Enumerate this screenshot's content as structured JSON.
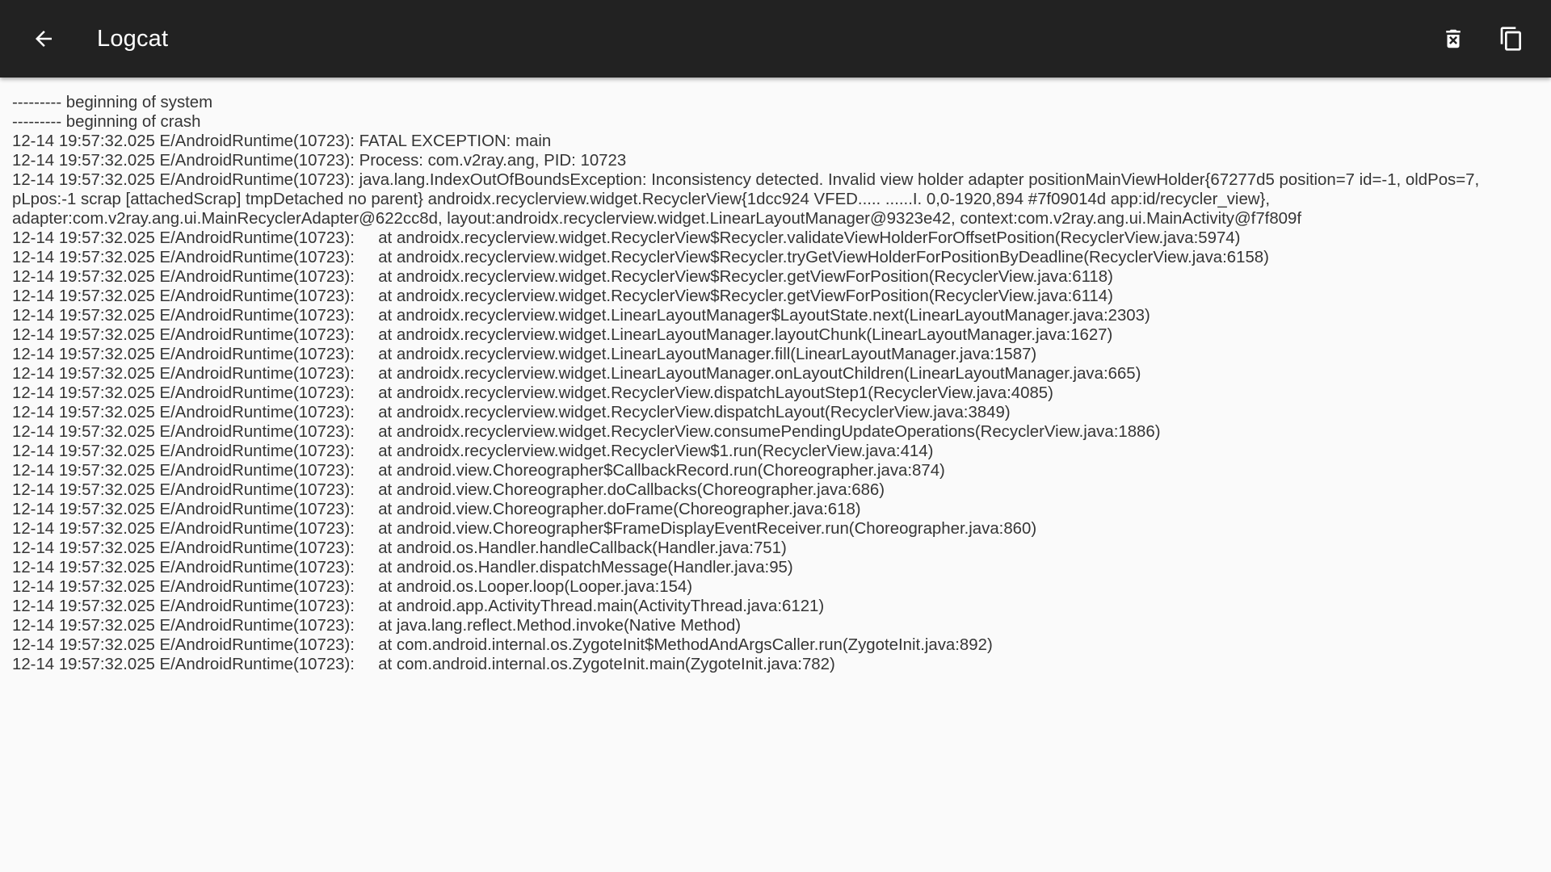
{
  "appbar": {
    "title": "Logcat",
    "back_icon": "arrow-back-icon",
    "delete_icon": "delete-icon",
    "copy_icon": "copy-icon"
  },
  "colors": {
    "appbar_bg": "#222222",
    "appbar_fg": "#ffffff",
    "content_bg": "#fafafa",
    "log_text": "#353535"
  },
  "log": {
    "text": "--------- beginning of system\n--------- beginning of crash\n12-14 19:57:32.025 E/AndroidRuntime(10723): FATAL EXCEPTION: main\n12-14 19:57:32.025 E/AndroidRuntime(10723): Process: com.v2ray.ang, PID: 10723\n12-14 19:57:32.025 E/AndroidRuntime(10723): java.lang.IndexOutOfBoundsException: Inconsistency detected. Invalid view holder adapter positionMainViewHolder{67277d5 position=7 id=-1, oldPos=7, pLpos:-1 scrap [attachedScrap] tmpDetached no parent} androidx.recyclerview.widget.RecyclerView{1dcc924 VFED..... ......I. 0,0-1920,894 #7f09014d app:id/recycler_view}, adapter:com.v2ray.ang.ui.MainRecyclerAdapter@622cc8d, layout:androidx.recyclerview.widget.LinearLayoutManager@9323e42, context:com.v2ray.ang.ui.MainActivity@f7f809f\n12-14 19:57:32.025 E/AndroidRuntime(10723): \tat androidx.recyclerview.widget.RecyclerView$Recycler.validateViewHolderForOffsetPosition(RecyclerView.java:5974)\n12-14 19:57:32.025 E/AndroidRuntime(10723): \tat androidx.recyclerview.widget.RecyclerView$Recycler.tryGetViewHolderForPositionByDeadline(RecyclerView.java:6158)\n12-14 19:57:32.025 E/AndroidRuntime(10723): \tat androidx.recyclerview.widget.RecyclerView$Recycler.getViewForPosition(RecyclerView.java:6118)\n12-14 19:57:32.025 E/AndroidRuntime(10723): \tat androidx.recyclerview.widget.RecyclerView$Recycler.getViewForPosition(RecyclerView.java:6114)\n12-14 19:57:32.025 E/AndroidRuntime(10723): \tat androidx.recyclerview.widget.LinearLayoutManager$LayoutState.next(LinearLayoutManager.java:2303)\n12-14 19:57:32.025 E/AndroidRuntime(10723): \tat androidx.recyclerview.widget.LinearLayoutManager.layoutChunk(LinearLayoutManager.java:1627)\n12-14 19:57:32.025 E/AndroidRuntime(10723): \tat androidx.recyclerview.widget.LinearLayoutManager.fill(LinearLayoutManager.java:1587)\n12-14 19:57:32.025 E/AndroidRuntime(10723): \tat androidx.recyclerview.widget.LinearLayoutManager.onLayoutChildren(LinearLayoutManager.java:665)\n12-14 19:57:32.025 E/AndroidRuntime(10723): \tat androidx.recyclerview.widget.RecyclerView.dispatchLayoutStep1(RecyclerView.java:4085)\n12-14 19:57:32.025 E/AndroidRuntime(10723): \tat androidx.recyclerview.widget.RecyclerView.dispatchLayout(RecyclerView.java:3849)\n12-14 19:57:32.025 E/AndroidRuntime(10723): \tat androidx.recyclerview.widget.RecyclerView.consumePendingUpdateOperations(RecyclerView.java:1886)\n12-14 19:57:32.025 E/AndroidRuntime(10723): \tat androidx.recyclerview.widget.RecyclerView$1.run(RecyclerView.java:414)\n12-14 19:57:32.025 E/AndroidRuntime(10723): \tat android.view.Choreographer$CallbackRecord.run(Choreographer.java:874)\n12-14 19:57:32.025 E/AndroidRuntime(10723): \tat android.view.Choreographer.doCallbacks(Choreographer.java:686)\n12-14 19:57:32.025 E/AndroidRuntime(10723): \tat android.view.Choreographer.doFrame(Choreographer.java:618)\n12-14 19:57:32.025 E/AndroidRuntime(10723): \tat android.view.Choreographer$FrameDisplayEventReceiver.run(Choreographer.java:860)\n12-14 19:57:32.025 E/AndroidRuntime(10723): \tat android.os.Handler.handleCallback(Handler.java:751)\n12-14 19:57:32.025 E/AndroidRuntime(10723): \tat android.os.Handler.dispatchMessage(Handler.java:95)\n12-14 19:57:32.025 E/AndroidRuntime(10723): \tat android.os.Looper.loop(Looper.java:154)\n12-14 19:57:32.025 E/AndroidRuntime(10723): \tat android.app.ActivityThread.main(ActivityThread.java:6121)\n12-14 19:57:32.025 E/AndroidRuntime(10723): \tat java.lang.reflect.Method.invoke(Native Method)\n12-14 19:57:32.025 E/AndroidRuntime(10723): \tat com.android.internal.os.ZygoteInit$MethodAndArgsCaller.run(ZygoteInit.java:892)\n12-14 19:57:32.025 E/AndroidRuntime(10723): \tat com.android.internal.os.ZygoteInit.main(ZygoteInit.java:782)"
  }
}
